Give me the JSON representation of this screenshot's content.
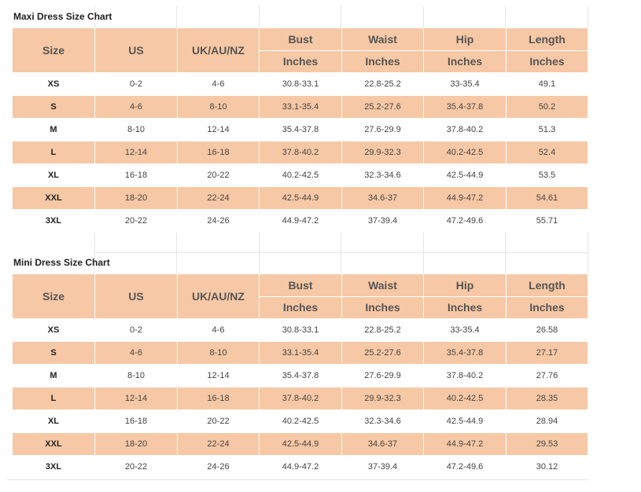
{
  "colors": {
    "header_bg": "#f7c8a5",
    "stripe_bg": "#f7c8a5",
    "row_bg": "#ffffff"
  },
  "columns": {
    "size": "Size",
    "us": "US",
    "uk": "UK/AU/NZ",
    "bust": "Bust",
    "waist": "Waist",
    "hip": "Hip",
    "length": "Length",
    "unit": "Inches"
  },
  "maxi": {
    "title": "Maxi Dress Size Chart",
    "rows": [
      {
        "size": "XS",
        "us": "0-2",
        "uk": "4-6",
        "bust": "30.8-33.1",
        "waist": "22.8-25.2",
        "hip": "33-35.4",
        "length": "49.1"
      },
      {
        "size": "S",
        "us": "4-6",
        "uk": "8-10",
        "bust": "33.1-35.4",
        "waist": "25.2-27.6",
        "hip": "35.4-37.8",
        "length": "50.2"
      },
      {
        "size": "M",
        "us": "8-10",
        "uk": "12-14",
        "bust": "35.4-37.8",
        "waist": "27.6-29.9",
        "hip": "37.8-40.2",
        "length": "51.3"
      },
      {
        "size": "L",
        "us": "12-14",
        "uk": "16-18",
        "bust": "37.8-40.2",
        "waist": "29.9-32.3",
        "hip": "40.2-42.5",
        "length": "52.4"
      },
      {
        "size": "XL",
        "us": "16-18",
        "uk": "20-22",
        "bust": "40.2-42.5",
        "waist": "32.3-34.6",
        "hip": "42.5-44.9",
        "length": "53.5"
      },
      {
        "size": "XXL",
        "us": "18-20",
        "uk": "22-24",
        "bust": "42.5-44.9",
        "waist": "34.6-37",
        "hip": "44.9-47.2",
        "length": "54.61"
      },
      {
        "size": "3XL",
        "us": "20-22",
        "uk": "24-26",
        "bust": "44.9-47.2",
        "waist": "37-39.4",
        "hip": "47.2-49.6",
        "length": "55.71"
      }
    ]
  },
  "mini": {
    "title": "Mini Dress Size Chart",
    "rows": [
      {
        "size": "XS",
        "us": "0-2",
        "uk": "4-6",
        "bust": "30.8-33.1",
        "waist": "22.8-25.2",
        "hip": "33-35.4",
        "length": "26.58"
      },
      {
        "size": "S",
        "us": "4-6",
        "uk": "8-10",
        "bust": "33.1-35.4",
        "waist": "25.2-27.6",
        "hip": "35.4-37.8",
        "length": "27.17"
      },
      {
        "size": "M",
        "us": "8-10",
        "uk": "12-14",
        "bust": "35.4-37.8",
        "waist": "27.6-29.9",
        "hip": "37.8-40.2",
        "length": "27.76"
      },
      {
        "size": "L",
        "us": "12-14",
        "uk": "16-18",
        "bust": "37.8-40.2",
        "waist": "29.9-32.3",
        "hip": "40.2-42.5",
        "length": "28.35"
      },
      {
        "size": "XL",
        "us": "16-18",
        "uk": "20-22",
        "bust": "40.2-42.5",
        "waist": "32.3-34.6",
        "hip": "42.5-44.9",
        "length": "28.94"
      },
      {
        "size": "XXL",
        "us": "18-20",
        "uk": "22-24",
        "bust": "42.5-44.9",
        "waist": "34.6-37",
        "hip": "44.9-47.2",
        "length": "29.53"
      },
      {
        "size": "3XL",
        "us": "20-22",
        "uk": "24-26",
        "bust": "44.9-47.2",
        "waist": "37-39.4",
        "hip": "47.2-49.6",
        "length": "30.12"
      }
    ]
  }
}
